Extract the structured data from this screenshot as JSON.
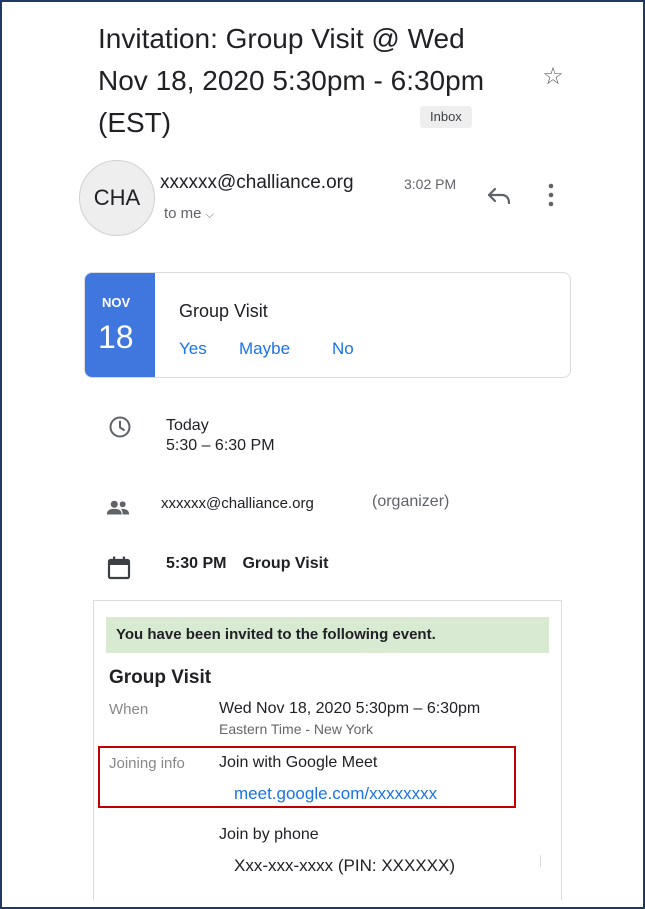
{
  "email": {
    "subject": "Invitation: Group Visit  @ Wed Nov 18, 2020 5:30pm - 6:30pm (EST)",
    "label_badge": "Inbox",
    "avatar_initials": "CHA",
    "sender": "xxxxxx@challiance.org",
    "time": "3:02 PM",
    "recipient": "to me",
    "icons": {
      "star": "star-outline-icon",
      "reply": "reply-icon",
      "more": "more-vertical-icon",
      "chevron": "chevron-down-icon"
    }
  },
  "event_card": {
    "month": "NOV",
    "day": "18",
    "title": "Group Visit",
    "rsvp": {
      "yes": "Yes",
      "maybe": "Maybe",
      "no": "No"
    },
    "accent_color": "#3f77df",
    "link_color": "#1a73e8"
  },
  "details": {
    "when_day": "Today",
    "when_time": "5:30 – 6:30 PM",
    "organizer_email": "xxxxxx@challiance.org",
    "organizer_role": "(organizer)",
    "calendar_time": "5:30 PM",
    "calendar_title": "Group Visit",
    "icons": {
      "clock": "clock-icon",
      "people": "people-icon",
      "calendar": "calendar-icon"
    }
  },
  "invite": {
    "banner": "You have been invited to the following event.",
    "banner_color": "#d9ead3",
    "title": "Group Visit",
    "when_label": "When",
    "when_value": "Wed Nov 18, 2020 5:30pm – 6:30pm",
    "timezone": "Eastern Time - New York",
    "joining_label": "Joining info",
    "join_meet": "Join with Google Meet",
    "meet_link": "meet.google.com/xxxxxxxx",
    "join_phone": "Join by phone",
    "phone": "Xxx-xxx-xxxx (PIN: XXXXXX)",
    "highlight_color": "#c00000"
  }
}
